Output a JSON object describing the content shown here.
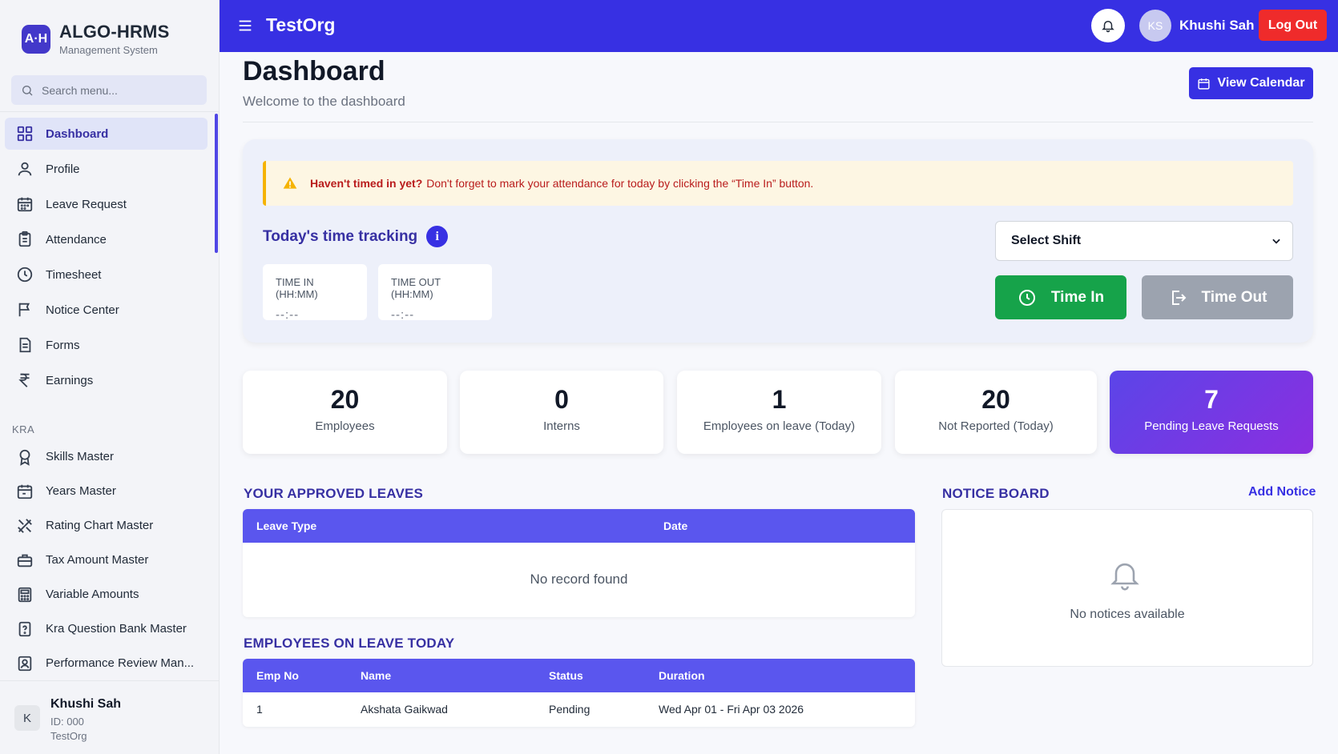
{
  "brand": {
    "logo": "A·H",
    "title": "ALGO-HRMS",
    "subtitle": "Management System"
  },
  "search": {
    "placeholder": "Search menu..."
  },
  "sidebar": {
    "items": [
      {
        "label": "Dashboard",
        "icon": "grid-icon",
        "active": true
      },
      {
        "label": "Profile",
        "icon": "user-icon"
      },
      {
        "label": "Leave Request",
        "icon": "calendar-icon"
      },
      {
        "label": "Attendance",
        "icon": "clipboard-icon"
      },
      {
        "label": "Timesheet",
        "icon": "clock-icon"
      },
      {
        "label": "Notice Center",
        "icon": "flag-icon"
      },
      {
        "label": "Forms",
        "icon": "document-icon"
      },
      {
        "label": "Earnings",
        "icon": "rupee-icon"
      }
    ],
    "section_label": "KRA",
    "kra_items": [
      {
        "label": "Skills Master",
        "icon": "award-icon"
      },
      {
        "label": "Years Master",
        "icon": "calendar-icon"
      },
      {
        "label": "Rating Chart Master",
        "icon": "pencil-ruler-icon"
      },
      {
        "label": "Tax Amount Master",
        "icon": "briefcase-icon"
      },
      {
        "label": "Variable Amounts",
        "icon": "calculator-icon"
      },
      {
        "label": "Kra Question Bank Master",
        "icon": "question-file-icon"
      },
      {
        "label": "Performance Review Man...",
        "icon": "review-icon"
      }
    ],
    "footer": {
      "avatar": "K",
      "name": "Khushi Sah",
      "id": "ID: 000",
      "org": "TestOrg"
    }
  },
  "topbar": {
    "org": "TestOrg",
    "avatar_initials": "KS",
    "user_name": "Khushi Sah",
    "logout_label": "Log Out"
  },
  "header": {
    "title": "Dashboard",
    "subtitle": "Welcome to the dashboard",
    "view_calendar_label": "View Calendar"
  },
  "tracker": {
    "alert_strong": "Haven't timed in yet?",
    "alert_text": "Don't forget to mark your attendance for today by clicking the “Time In” button.",
    "title": "Today's time tracking",
    "info_glyph": "i",
    "time_in_label": "TIME IN (HH:MM)",
    "time_in_value": "--:--",
    "time_out_label": "TIME OUT (HH:MM)",
    "time_out_value": "--:--",
    "shift_selected": "Select Shift",
    "time_in_button": "Time In",
    "time_out_button": "Time Out"
  },
  "stats": [
    {
      "value": "20",
      "label": "Employees"
    },
    {
      "value": "0",
      "label": "Interns"
    },
    {
      "value": "1",
      "label": "Employees on leave (Today)"
    },
    {
      "value": "20",
      "label": "Not Reported (Today)"
    },
    {
      "value": "7",
      "label": "Pending Leave Requests"
    }
  ],
  "approved_leaves": {
    "title": "YOUR APPROVED LEAVES",
    "columns": [
      "Leave Type",
      "Date"
    ],
    "empty_text": "No record found"
  },
  "on_leave": {
    "title": "EMPLOYEES ON LEAVE TODAY",
    "columns": [
      "Emp No",
      "Name",
      "Status",
      "Duration"
    ],
    "rows": [
      [
        "1",
        "Akshata Gaikwad",
        "Pending",
        "Wed Apr 01 - Fri Apr 03 2026"
      ]
    ]
  },
  "notice_board": {
    "title": "NOTICE BOARD",
    "add_label": "Add Notice",
    "empty_text": "No notices available"
  },
  "colors": {
    "primary": "#3730e3",
    "danger": "#ef2b2b",
    "success": "#16a34a",
    "warning": "#f5b301",
    "table_header": "#5a56ee"
  }
}
